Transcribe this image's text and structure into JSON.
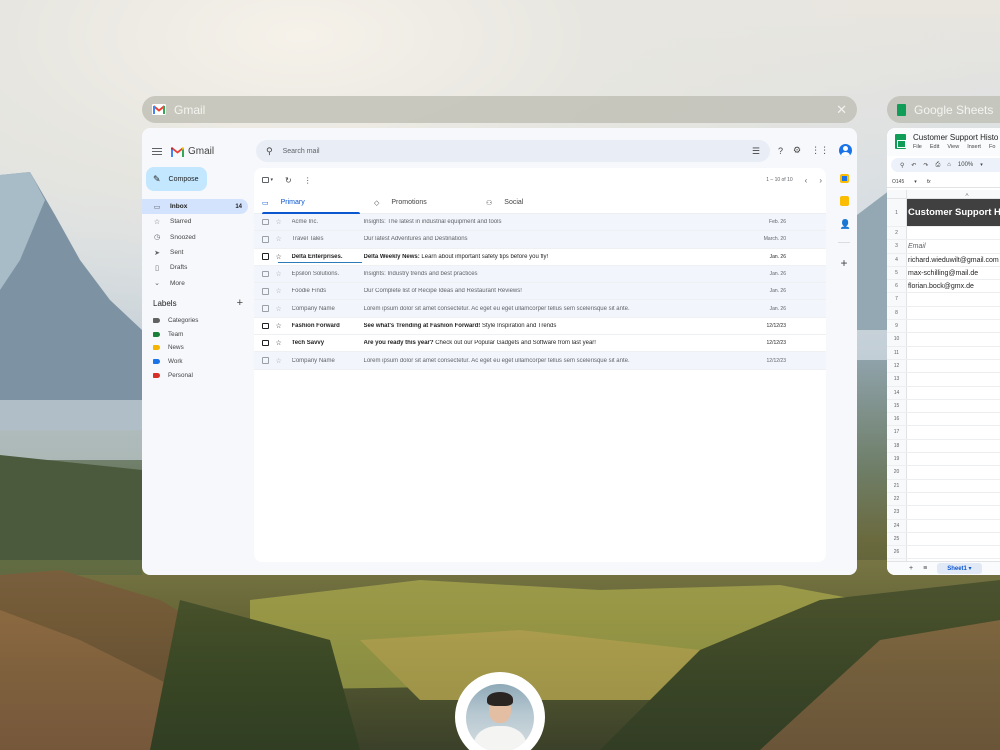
{
  "gmail_window": {
    "bar_title": "Gmail",
    "brand": "Gmail",
    "compose_label": "Compose",
    "search_placeholder": "Search mail",
    "pager": "1 – 10 of 10",
    "nav": [
      {
        "label": "Inbox",
        "count": "14",
        "icon": "inbox-icon"
      },
      {
        "label": "Starred",
        "icon": "star-icon"
      },
      {
        "label": "Snoozed",
        "icon": "clock-icon"
      },
      {
        "label": "Sent",
        "icon": "send-icon"
      },
      {
        "label": "Drafts",
        "icon": "draft-icon"
      },
      {
        "label": "More",
        "icon": "chevron-down-icon"
      }
    ],
    "labels_title": "Labels",
    "labels": [
      {
        "label": "Categories",
        "color": "#616161"
      },
      {
        "label": "Team",
        "color": "#188038"
      },
      {
        "label": "News",
        "color": "#f4b400"
      },
      {
        "label": "Work",
        "color": "#1a73e8"
      },
      {
        "label": "Personal",
        "color": "#d93025"
      }
    ],
    "tabs": [
      {
        "label": "Primary",
        "icon": "inbox-icon"
      },
      {
        "label": "Promotions",
        "icon": "tag-icon"
      },
      {
        "label": "Social",
        "icon": "people-icon"
      }
    ],
    "emails": [
      {
        "sender": "Acme Inc.",
        "subject": "",
        "snippet": "Insights: The latest in industrial equipment and tools",
        "date": "Feb. 26",
        "unread": false
      },
      {
        "sender": "Travel Tales",
        "subject": "",
        "snippet": "Our latest Adventures and Destinations",
        "date": "March. 20",
        "unread": false
      },
      {
        "sender": "Delta Enterprises.",
        "subject": "Delta Weekly News:",
        "snippet": " Learn about important safety tips before you fly!",
        "date": "Jan. 26",
        "unread": true
      },
      {
        "sender": "Epsilon Solutions.",
        "subject": "",
        "snippet": "Insights: Industry trends and best practices",
        "date": "Jan. 26",
        "unread": false
      },
      {
        "sender": "Foodie Finds",
        "subject": "",
        "snippet": "Our Complete list of Recipe Ideas and Restaurant Reviews!",
        "date": "Jan. 26",
        "unread": false
      },
      {
        "sender": "Company Name",
        "subject": "",
        "snippet": "Lorem ipsum dolor sit amet consectetur. Ac eget eu eget ullamcorper tellus sem scelerisque sit ante.",
        "date": "Jan. 26",
        "unread": false
      },
      {
        "sender": "Fashion Forward",
        "subject": "See what's Trending at Fashion Forward!",
        "snippet": " Style Inspiration and Trends",
        "date": "12/12/23",
        "unread": true
      },
      {
        "sender": "Tech Savvy",
        "subject": "Are you ready this year?",
        "snippet": " Check out our Popular Gadgets and Software from last year!",
        "date": "12/12/23",
        "unread": true
      },
      {
        "sender": "Company Name",
        "subject": "",
        "snippet": "Lorem ipsum dolor sit amet consectetur. Ac eget eu eget ullamcorper tellus sem scelerisque sit ante.",
        "date": "12/12/23",
        "unread": false
      }
    ]
  },
  "sheets_window": {
    "bar_title": "Google Sheets",
    "doc_title": "Customer Support Histo",
    "menu": [
      "File",
      "Edit",
      "View",
      "Insert",
      "Fo"
    ],
    "zoom": "100%",
    "cell_ref": "O145",
    "fx": "fx",
    "column_a": "A",
    "banner": "Customer Support H",
    "email_header": "Email",
    "emails": [
      "richard.wieduwilt@gmail.com",
      "max-schilling@mail.de",
      "florian.bock@gmx.de"
    ],
    "sheet_tab": "Sheet1"
  }
}
